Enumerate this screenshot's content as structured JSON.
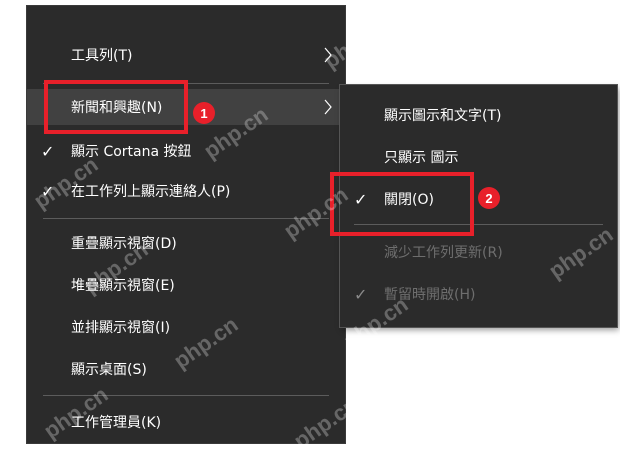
{
  "main_menu": {
    "items": [
      {
        "label": "工具列(T)"
      },
      {
        "label": "新聞和興趣(N)"
      },
      {
        "label": "顯示 Cortana 按鈕"
      },
      {
        "label": "在工作列上顯示連絡人(P)"
      },
      {
        "label": "重疊顯示視窗(D)"
      },
      {
        "label": "堆疊顯示視窗(E)"
      },
      {
        "label": "並排顯示視窗(I)"
      },
      {
        "label": "顯示桌面(S)"
      },
      {
        "label": "工作管理員(K)"
      }
    ]
  },
  "sub_menu": {
    "items": [
      {
        "label": "顯示圖示和文字(T)"
      },
      {
        "label": "只顯示 圖示"
      },
      {
        "label": "關閉(O)"
      },
      {
        "label": "減少工作列更新(R)"
      },
      {
        "label": "暫留時開啟(H)"
      }
    ]
  },
  "callouts": {
    "first": "1",
    "second": "2"
  },
  "watermark": "php.cn",
  "colors": {
    "menu_bg": "#2b2b2b",
    "callout_red": "#e8202a",
    "disabled_text": "#6e6e6e"
  }
}
